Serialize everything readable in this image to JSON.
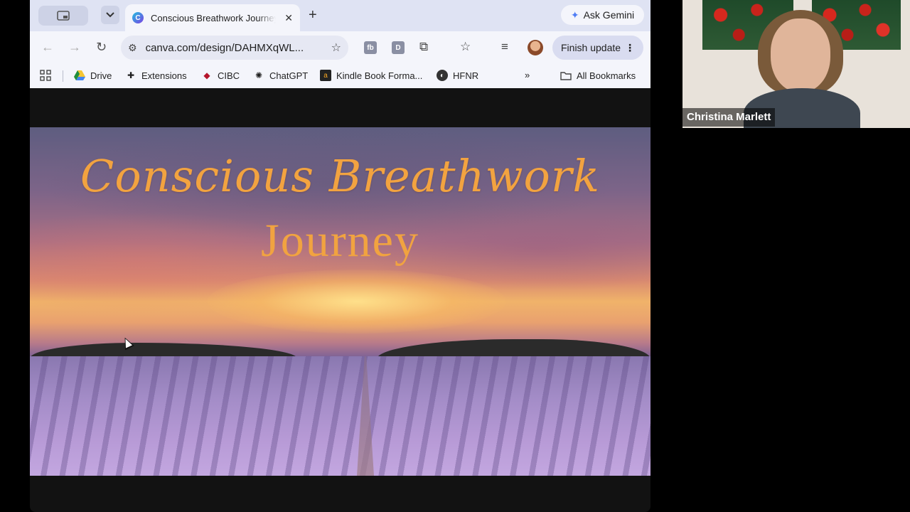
{
  "browser": {
    "tab": {
      "favicon_letter": "C",
      "title": "Conscious Breathwork Journey"
    },
    "gemini_label": "Ask Gemini",
    "address": {
      "url": "canva.com/design/DAHMXqWL..."
    },
    "finish_update_label": "Finish update",
    "extensions": [
      {
        "letter": "fb"
      },
      {
        "letter": "D"
      }
    ],
    "bookmarks": [
      {
        "label": "Drive",
        "icon": "drive-icon"
      },
      {
        "label": "Extensions",
        "icon": "puzzle-icon"
      },
      {
        "label": "CIBC",
        "icon": "cibc-icon"
      },
      {
        "label": "ChatGPT",
        "icon": "chatgpt-icon"
      },
      {
        "label": "Kindle Book Forma...",
        "icon": "kindle-icon"
      },
      {
        "label": "HFNR",
        "icon": "globe-icon"
      }
    ],
    "all_bookmarks_label": "All Bookmarks"
  },
  "slide": {
    "title": "Conscious Breathwork",
    "subtitle": "Journey"
  },
  "video": {
    "participant_name": "Christina Marlett"
  },
  "colors": {
    "title_orange": "#f2a340",
    "tabstrip": "#dfe3f3",
    "toolbar": "#f4f5fb"
  }
}
